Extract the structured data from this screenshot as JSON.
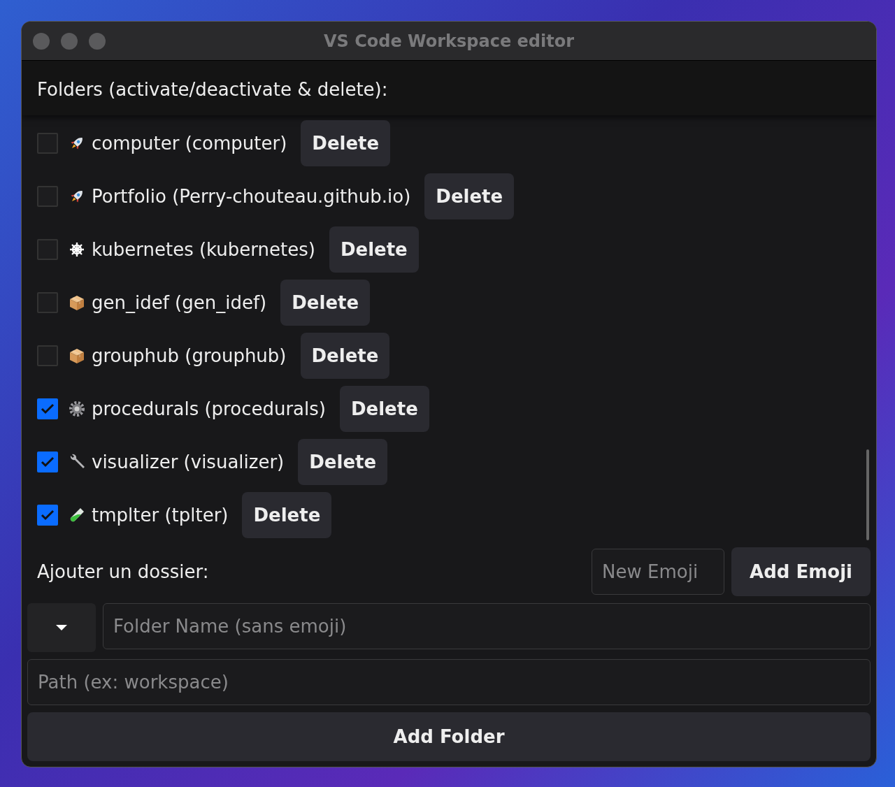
{
  "window": {
    "title": "VS Code Workspace editor"
  },
  "folders_heading": "Folders (activate/deactivate & delete):",
  "folders": [
    {
      "kind": "rocket",
      "label": "computer (computer)",
      "checked": false,
      "delete_label": "Delete"
    },
    {
      "kind": "rocket",
      "label": "Portfolio (Perry-chouteau.github.io)",
      "checked": false,
      "delete_label": "Delete"
    },
    {
      "kind": "helm",
      "label": "kubernetes (kubernetes)",
      "checked": false,
      "delete_label": "Delete"
    },
    {
      "kind": "box",
      "label": "gen_idef (gen_idef)",
      "checked": false,
      "delete_label": "Delete"
    },
    {
      "kind": "box",
      "label": "grouphub (grouphub)",
      "checked": false,
      "delete_label": "Delete"
    },
    {
      "kind": "gear",
      "label": "procedurals (procedurals)",
      "checked": true,
      "delete_label": "Delete"
    },
    {
      "kind": "wrench",
      "label": "visualizer (visualizer)",
      "checked": true,
      "delete_label": "Delete"
    },
    {
      "kind": "test-tube",
      "label": "tmplter (tplter)",
      "checked": true,
      "delete_label": "Delete"
    }
  ],
  "add_section": {
    "label": "Ajouter un dossier:",
    "emoji_field": {
      "placeholder": "New Emoji"
    },
    "add_emoji_button": "Add Emoji",
    "folder_name_field": {
      "placeholder": "Folder Name (sans emoji)"
    },
    "path_field": {
      "placeholder": "Path (ex: workspace)"
    },
    "add_folder_button": "Add Folder"
  }
}
